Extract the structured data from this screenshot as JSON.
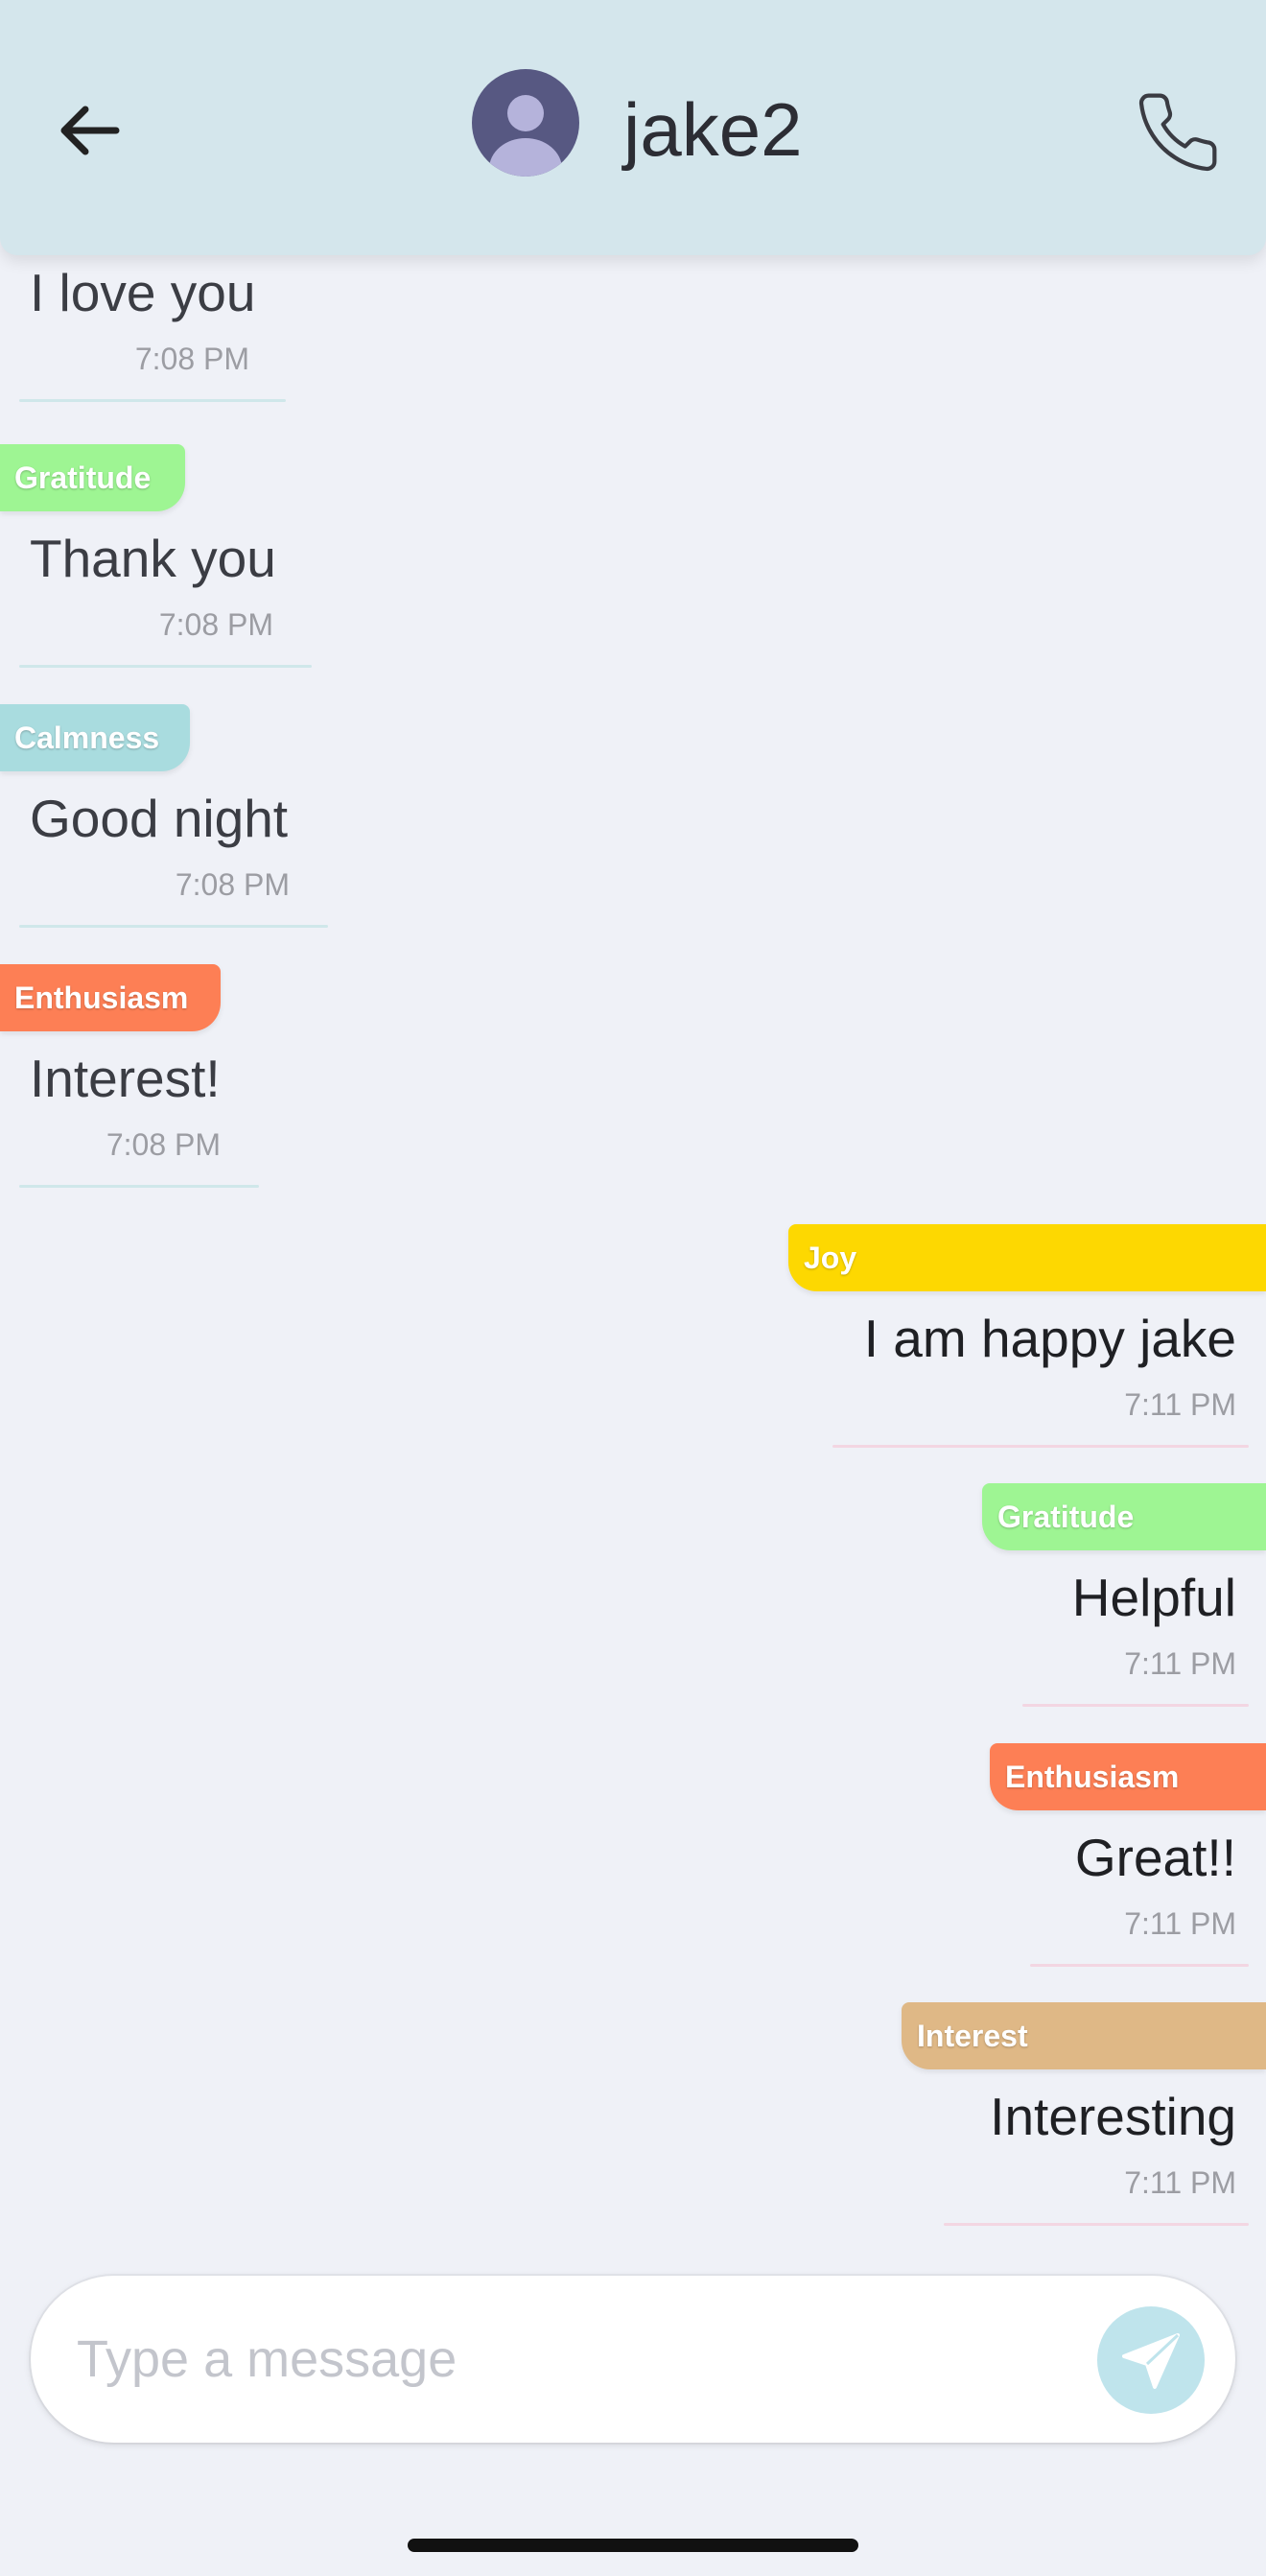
{
  "header": {
    "contact_name": "jake2"
  },
  "messages": [
    {
      "tag": "",
      "tag_color": "",
      "text": "I love you",
      "time": "7:08 PM",
      "side": "left"
    },
    {
      "tag": "Gratitude",
      "tag_color": "#9ef593",
      "text": "Thank you",
      "time": "7:08 PM",
      "side": "left"
    },
    {
      "tag": "Calmness",
      "tag_color": "#a9dcdf",
      "text": "Good night",
      "time": "7:08 PM",
      "side": "left"
    },
    {
      "tag": "Enthusiasm",
      "tag_color": "#fd7f55",
      "text": "Interest!",
      "time": "7:08 PM",
      "side": "left"
    },
    {
      "tag": "Joy",
      "tag_color": "#fdd801",
      "text": "I am happy jake",
      "time": "7:11 PM",
      "side": "right"
    },
    {
      "tag": "Gratitude",
      "tag_color": "#9ef593",
      "text": "Helpful",
      "time": "7:11 PM",
      "side": "right"
    },
    {
      "tag": "Enthusiasm",
      "tag_color": "#fd7f55",
      "text": "Great!!",
      "time": "7:11 PM",
      "side": "right"
    },
    {
      "tag": "Interest",
      "tag_color": "#dfb886",
      "text": "Interesting",
      "time": "7:11 PM",
      "side": "right"
    }
  ],
  "composer": {
    "placeholder": "Type a message",
    "send_icon": "send-icon"
  },
  "icons": {
    "back": "back-arrow-icon",
    "call": "phone-icon",
    "avatar": "avatar-icon"
  },
  "colors": {
    "header_bg": "#d4e6ec",
    "background": "#eff1f7",
    "send_button": "#bfe4ec"
  }
}
